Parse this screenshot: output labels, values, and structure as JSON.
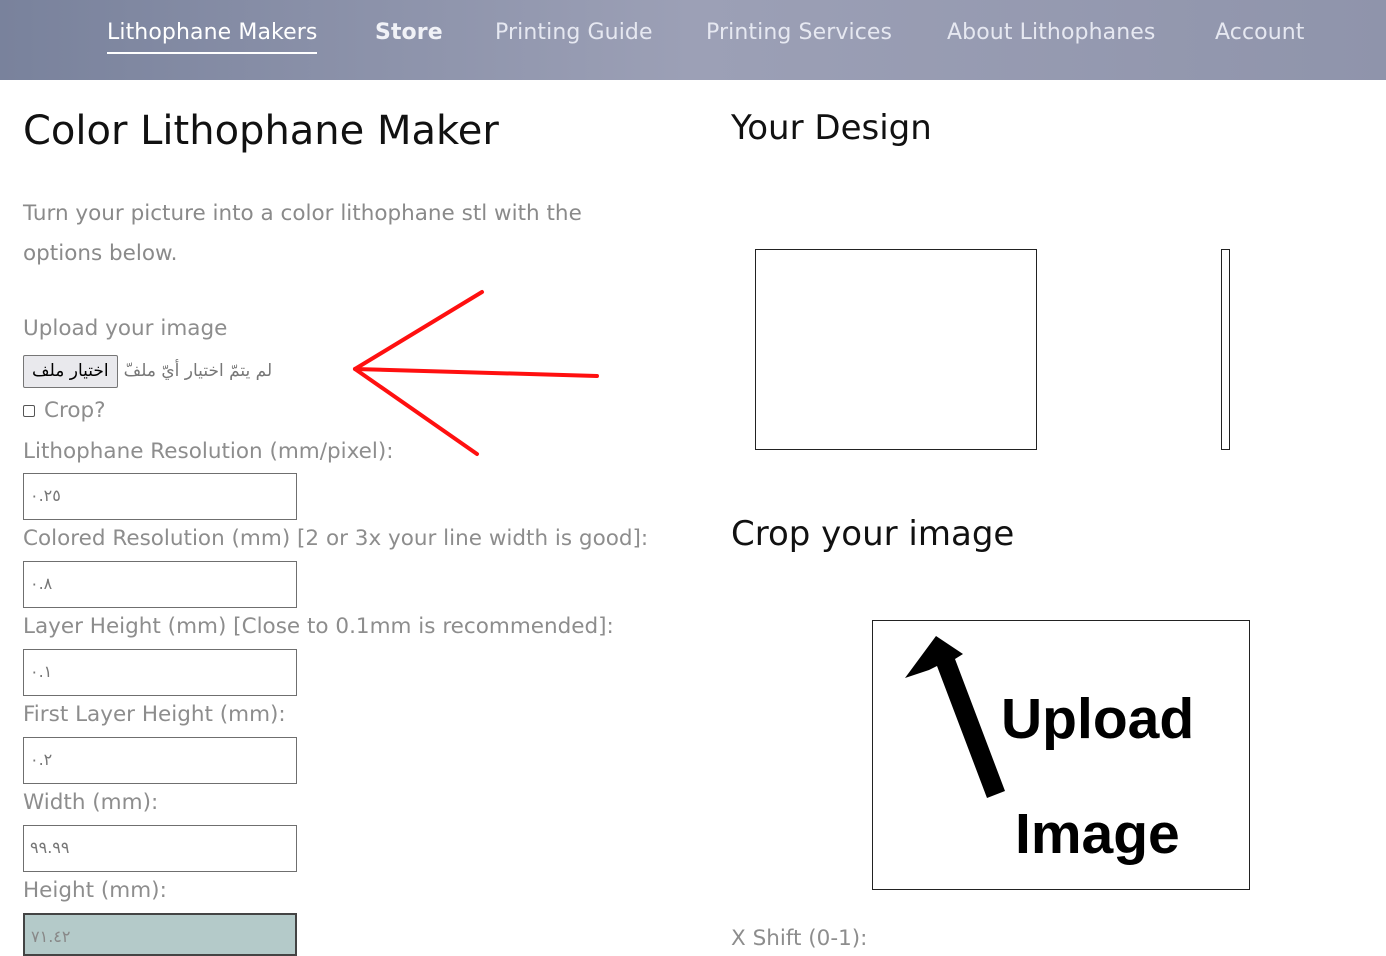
{
  "nav": {
    "items": [
      {
        "label": "Lithophane Makers"
      },
      {
        "label": "Store"
      },
      {
        "label": "Printing Guide"
      },
      {
        "label": "Printing Services"
      },
      {
        "label": "About Lithophanes"
      },
      {
        "label": "Account"
      }
    ]
  },
  "main": {
    "title": "Color Lithophane Maker",
    "intro": "Turn your picture into a color lithophane stl with the options below.",
    "upload_label": "Upload your image",
    "file_button_label": "اختيار ملف",
    "file_status": "لم يتمّ اختيار أيّ ملفّ",
    "crop_label": "Crop?",
    "fields": [
      {
        "label": "Lithophane Resolution (mm/pixel):",
        "value": "٠.٢٥"
      },
      {
        "label": "Colored Resolution (mm) [2 or 3x your line width is good]:",
        "value": "٠.٨"
      },
      {
        "label": "Layer Height (mm) [Close to 0.1mm is recommended]:",
        "value": "٠.١"
      },
      {
        "label": "First Layer Height (mm):",
        "value": "٠.٢"
      },
      {
        "label": "Width (mm):",
        "value": "٩٩.٩٩"
      },
      {
        "label": "Height (mm):",
        "value": "٧١.٤٢"
      }
    ]
  },
  "right": {
    "design_title": "Your Design",
    "crop_title": "Crop your image",
    "placeholder_line1": "Upload",
    "placeholder_line2": "Image",
    "xshift_label": "X Shift (0-1):"
  },
  "colors": {
    "nav_gradient_start": "#79829c",
    "nav_gradient_end": "#8f94ab",
    "annotation_arrow": "#ff0000",
    "height_field_bg": "#b4cac9"
  },
  "icons": {
    "upload_arrow": "upload-arrow-icon",
    "annotation": "red-arrow-icon"
  }
}
